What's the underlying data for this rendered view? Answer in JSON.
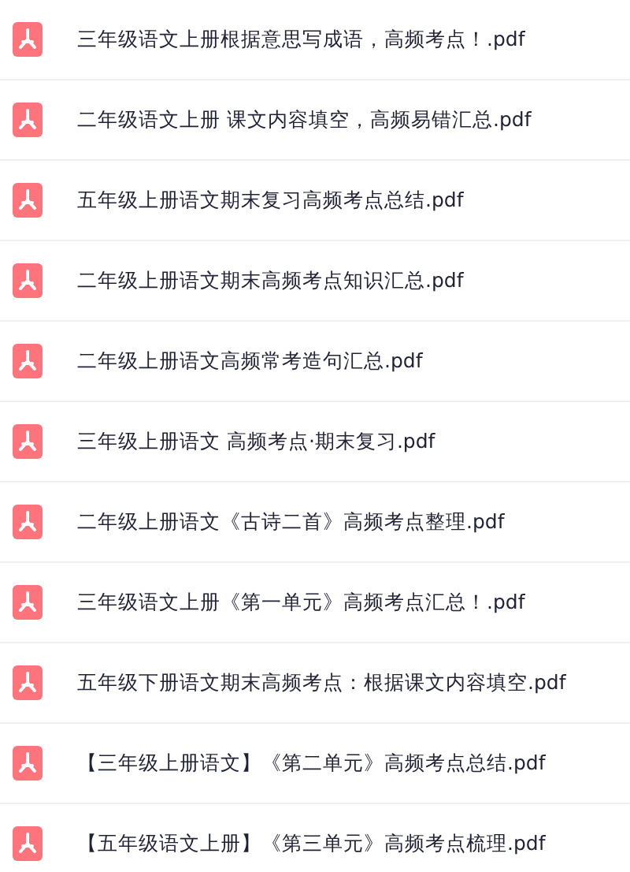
{
  "files": [
    {
      "name": "三年级语文上册根据意思写成语，高频考点！.pdf"
    },
    {
      "name": "二年级语文上册 课文内容填空，高频易错汇总.pdf"
    },
    {
      "name": "五年级上册语文期末复习高频考点总结.pdf"
    },
    {
      "name": "二年级上册语文期末高频考点知识汇总.pdf"
    },
    {
      "name": "二年级上册语文高频常考造句汇总.pdf"
    },
    {
      "name": "三年级上册语文 高频考点·期末复习.pdf"
    },
    {
      "name": "二年级上册语文《古诗二首》高频考点整理.pdf"
    },
    {
      "name": "三年级语文上册《第一单元》高频考点汇总！.pdf"
    },
    {
      "name": "五年级下册语文期末高频考点：根据课文内容填空.pdf"
    },
    {
      "name": "【三年级上册语文】《第二单元》高频考点总结.pdf"
    },
    {
      "name": "【五年级语文上册】《第三单元》高频考点梳理.pdf"
    }
  ]
}
